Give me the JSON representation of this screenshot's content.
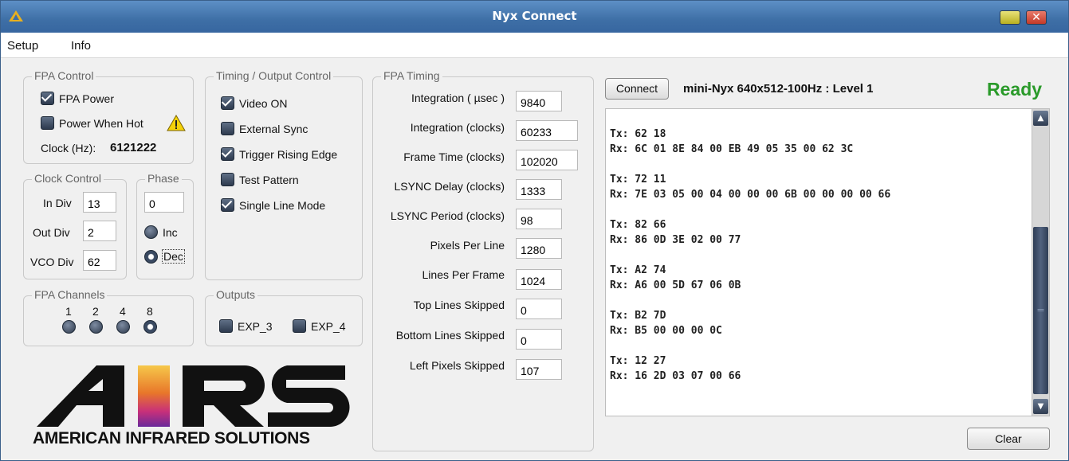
{
  "window": {
    "title": "Nyx Connect"
  },
  "menu": [
    "Setup",
    "Info"
  ],
  "fpa_control": {
    "legend": "FPA Control",
    "fpa_power": {
      "label": "FPA Power",
      "checked": true
    },
    "power_when_hot": {
      "label": "Power When Hot",
      "checked": false
    },
    "clock_label": "Clock (Hz):",
    "clock_value": "6121222"
  },
  "timing_output": {
    "legend": "Timing / Output Control",
    "items": [
      {
        "label": "Video ON",
        "checked": true
      },
      {
        "label": "External Sync",
        "checked": false
      },
      {
        "label": "Trigger Rising Edge",
        "checked": true
      },
      {
        "label": "Test Pattern",
        "checked": false
      },
      {
        "label": "Single Line Mode",
        "checked": true
      }
    ]
  },
  "clock_control": {
    "legend": "Clock Control",
    "in_div": {
      "label": "In Div",
      "value": "13"
    },
    "out_div": {
      "label": "Out Div",
      "value": "2"
    },
    "vco_div": {
      "label": "VCO Div",
      "value": "62"
    }
  },
  "phase": {
    "legend": "Phase",
    "value": "0",
    "inc": {
      "label": "Inc",
      "selected": false
    },
    "dec": {
      "label": "Dec",
      "selected": true
    }
  },
  "fpa_channels": {
    "legend": "FPA Channels",
    "options": [
      {
        "label": "1",
        "selected": false
      },
      {
        "label": "2",
        "selected": false
      },
      {
        "label": "4",
        "selected": false
      },
      {
        "label": "8",
        "selected": true
      }
    ]
  },
  "outputs": {
    "legend": "Outputs",
    "items": [
      {
        "label": "EXP_3",
        "checked": false
      },
      {
        "label": "EXP_4",
        "checked": false
      }
    ]
  },
  "fpa_timing": {
    "legend": "FPA Timing",
    "fields": [
      {
        "label": "Integration ( µsec )",
        "value": "9840"
      },
      {
        "label": "Integration (clocks)",
        "value": "60233"
      },
      {
        "label": "Frame Time (clocks)",
        "value": "102020"
      },
      {
        "label": "LSYNC Delay (clocks)",
        "value": "1333"
      },
      {
        "label": "LSYNC Period (clocks)",
        "value": "98"
      },
      {
        "label": "Pixels Per Line",
        "value": "1280"
      },
      {
        "label": "Lines Per Frame",
        "value": "1024"
      },
      {
        "label": "Top Lines Skipped",
        "value": "0"
      },
      {
        "label": "Bottom Lines Skipped",
        "value": "0"
      },
      {
        "label": "Left Pixels Skipped",
        "value": "107"
      }
    ]
  },
  "connection": {
    "connect_label": "Connect",
    "device_label": "mini-Nyx 640x512-100Hz : Level 1",
    "status": "Ready",
    "status_color": "#2a9a2a"
  },
  "console": {
    "log": "Tx: 62 18\nRx: 6C 01 8E 84 00 EB 49 05 35 00 62 3C\n\nTx: 72 11\nRx: 7E 03 05 00 04 00 00 00 6B 00 00 00 00 66\n\nTx: 82 66\nRx: 86 0D 3E 02 00 77\n\nTx: A2 74\nRx: A6 00 5D 67 06 0B\n\nTx: B2 7D\nRx: B5 00 00 00 0C\n\nTx: 12 27\nRx: 16 2D 03 07 00 66"
  },
  "clear_label": "Clear",
  "logo": {
    "letters": "AIRS",
    "tagline": "AMERICAN INFRARED SOLUTIONS"
  }
}
